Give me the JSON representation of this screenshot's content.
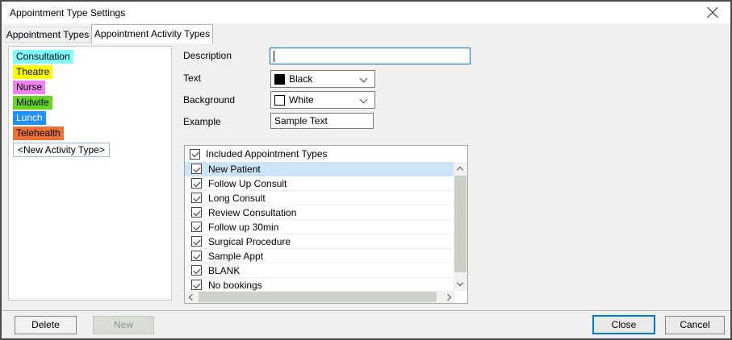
{
  "window": {
    "title": "Appointment Type Settings"
  },
  "tabs": [
    {
      "label": "Appointment Types",
      "active": false
    },
    {
      "label": "Appointment Activity Types",
      "active": true
    }
  ],
  "activity_types": {
    "items": [
      {
        "label": "Consultation",
        "bg": "#80ffff",
        "fg": "#000000"
      },
      {
        "label": "Theatre",
        "bg": "#ffff00",
        "fg": "#000000"
      },
      {
        "label": "Nurse",
        "bg": "#ee82ee",
        "fg": "#000000"
      },
      {
        "label": "Midwife",
        "bg": "#64d621",
        "fg": "#000000"
      },
      {
        "label": "Lunch",
        "bg": "#1e90ff",
        "fg": "#ffffff"
      },
      {
        "label": "Telehealth",
        "bg": "#ed7234",
        "fg": "#000000"
      }
    ],
    "new_item_label": "<New Activity Type>"
  },
  "form": {
    "description": {
      "label": "Description",
      "value": ""
    },
    "text_color": {
      "label": "Text",
      "value": "Black",
      "swatch": "#000000"
    },
    "background_color": {
      "label": "Background",
      "value": "White",
      "swatch": "#ffffff"
    },
    "example": {
      "label": "Example",
      "value": "Sample Text"
    }
  },
  "included_list": {
    "header": "Included Appointment Types",
    "header_checked": true,
    "items": [
      {
        "label": "New Patient",
        "checked": true,
        "selected": true
      },
      {
        "label": "Follow Up Consult",
        "checked": true,
        "selected": false
      },
      {
        "label": "Long Consult",
        "checked": true,
        "selected": false
      },
      {
        "label": "Review Consultation",
        "checked": true,
        "selected": false
      },
      {
        "label": "Follow up 30min",
        "checked": true,
        "selected": false
      },
      {
        "label": "Surgical Procedure",
        "checked": true,
        "selected": false
      },
      {
        "label": "Sample Appt",
        "checked": true,
        "selected": false
      },
      {
        "label": "BLANK",
        "checked": true,
        "selected": false
      },
      {
        "label": "No bookings",
        "checked": true,
        "selected": false
      }
    ]
  },
  "buttons": {
    "delete": "Delete",
    "new": "New",
    "close": "Close",
    "cancel": "Cancel"
  },
  "colors": {
    "accent": "#0078d7",
    "selection": "#cce4f7",
    "dialog_border": "#4b4b4e"
  },
  "icons": {
    "close_icon": "✕",
    "dropdown_chevron": "⌄",
    "scroll_up": "⌃",
    "scroll_down": "⌄",
    "scroll_left": "‹",
    "scroll_right": "›",
    "checkbox_check": "✓"
  }
}
